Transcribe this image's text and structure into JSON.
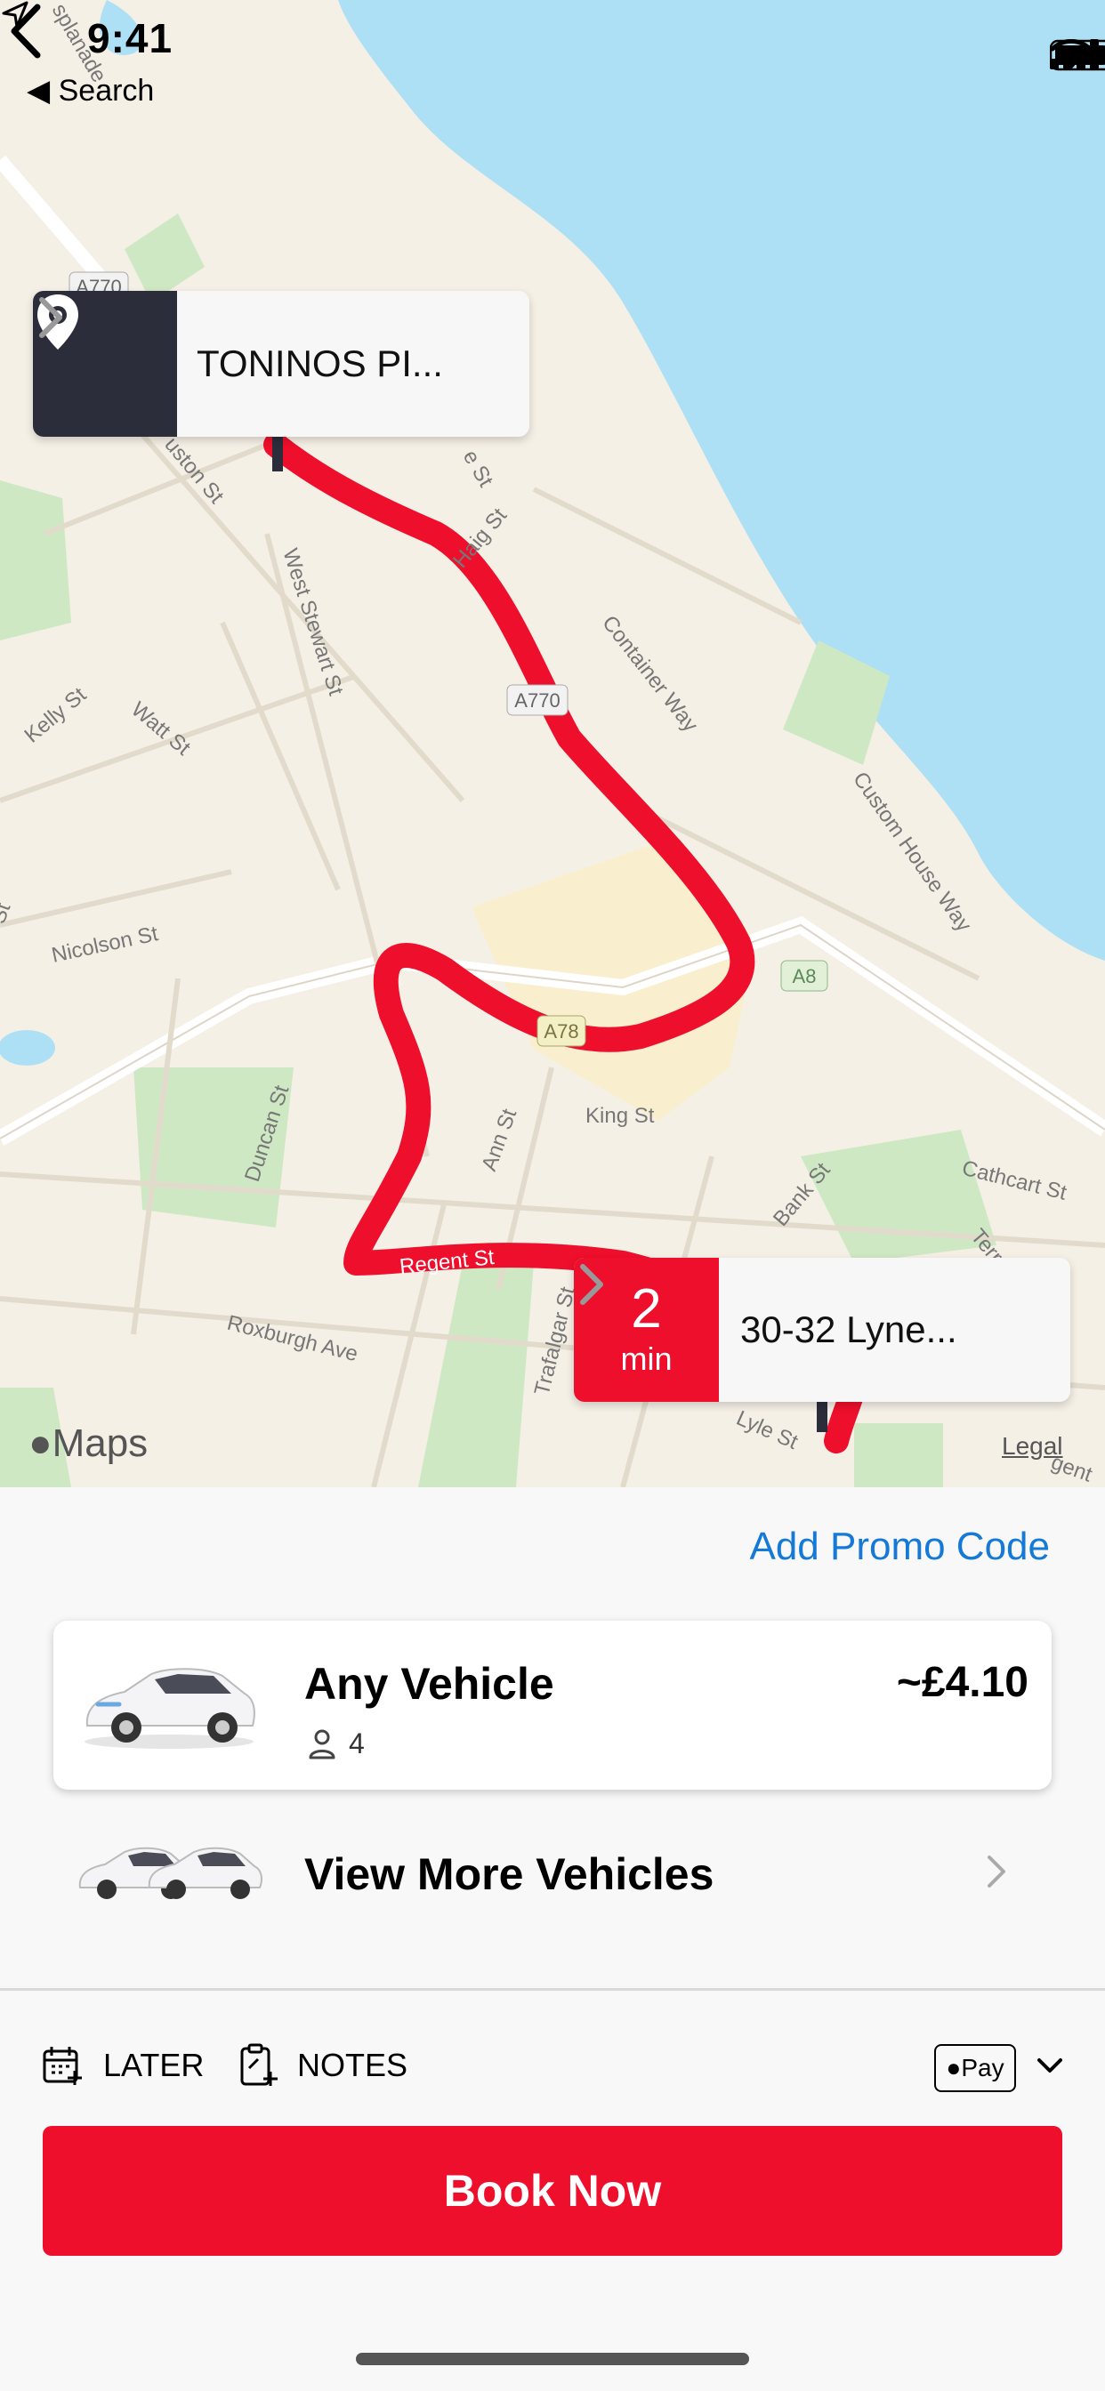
{
  "status_bar": {
    "time": "9:41",
    "back_app": "Search"
  },
  "map": {
    "labels": {
      "road_a770_top": "A770",
      "road_a770": "A770",
      "road_a8": "A8",
      "road_a78": "A78",
      "haig_st": "Haig St",
      "west_stewart_st": "West Stewart St",
      "container_way": "Container Way",
      "custom_house_way": "Custom House Way",
      "kelly_st": "Kelly St",
      "watt_st": "Watt St",
      "nicolson_st": "Nicolson St",
      "king_st": "King St",
      "ann_st": "Ann St",
      "duncan_st": "Duncan St",
      "bank_st": "Bank St",
      "cathcart_st": "Cathcart St",
      "terrace": "Terra",
      "regent_st": "Regent St",
      "roxburgh_ave": "Roxburgh Ave",
      "trafalgar_st": "Trafalgar St",
      "lyle_st": "Lyle St",
      "ouston_st": "uston St",
      "esplanade": "splanade",
      "st_left": "St",
      "st_small": "e St",
      "gent": "gent"
    },
    "pickup": {
      "name": "TONINOS PI..."
    },
    "eta": {
      "value": "2",
      "unit": "min",
      "address": "30-32 Lyne..."
    },
    "attribution": "Maps",
    "legal": "Legal",
    "colors": {
      "route": "#ee0f2c",
      "water": "#aee0f5",
      "land": "#f5f0e6",
      "park": "#cfe8c4"
    }
  },
  "panel": {
    "promo_label": "Add Promo Code",
    "vehicle": {
      "name": "Any Vehicle",
      "price": "~£4.10",
      "passengers": "4"
    },
    "more_label": "View More Vehicles",
    "later_label": "LATER",
    "notes_label": "NOTES",
    "payment_label": "Pay",
    "book_label": "Book Now",
    "colors": {
      "accent": "#ee0f2c",
      "link": "#1479d7"
    }
  }
}
